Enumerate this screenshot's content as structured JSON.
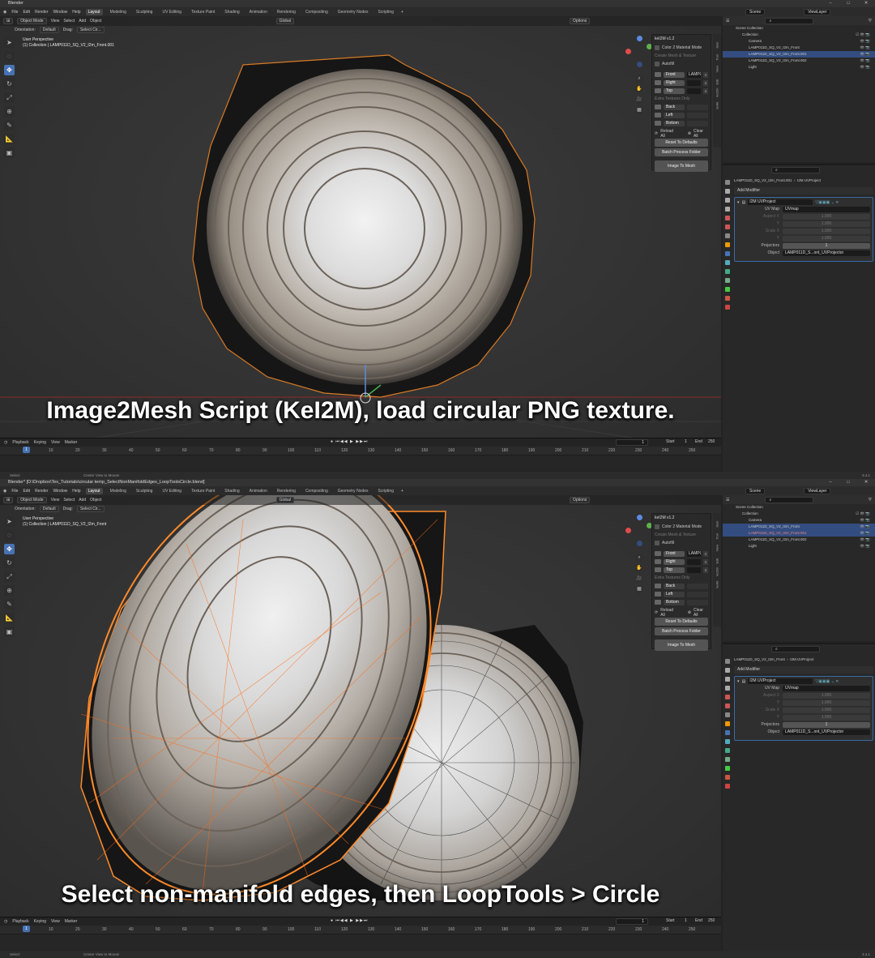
{
  "titlebar": {
    "top": "Blender",
    "bottom": "Blender* [D:\\Dropbox\\Tex_Tutorials\\circular temp_SelectNonManifoldEdges_LoopToolsCircle.blend]"
  },
  "menus": [
    "File",
    "Edit",
    "Render",
    "Window",
    "Help"
  ],
  "workspaces": [
    "Layout",
    "Modeling",
    "Sculpting",
    "UV Editing",
    "Texture Paint",
    "Shading",
    "Animation",
    "Rendering",
    "Compositing",
    "Geometry Nodes",
    "Scripting"
  ],
  "scene": "Scene",
  "view_layer": "ViewLayer",
  "header": {
    "mode": "Object Mode",
    "view": "View",
    "select": "Select",
    "add": "Add",
    "object": "Object",
    "transform": "Global",
    "options": "Options"
  },
  "header2": {
    "orientation": "Orientation:",
    "default": "Default",
    "drag": "Drag:",
    "select_mode": "Select Cir..."
  },
  "top": {
    "overlay_title": "User Perspective",
    "overlay_obj": "(1) Collection | LAMP011D_SQ_V2_I2m_Front.001",
    "caption": "Image2Mesh Script (KeI2M), load circular PNG texture."
  },
  "bottom": {
    "overlay_title": "User Perspective",
    "overlay_obj": "(1) Collection | LAMP011D_SQ_V2_I2m_Front",
    "caption": "Select non-manifold edges, then LoopTools > Circle"
  },
  "npanel": {
    "title": "keI2M v1.2",
    "color2": "Color 2 Material Mode",
    "create": "Create Mesh & Texture",
    "autofill": "Autofill",
    "front": "Front",
    "front_img": "LAMP011...",
    "right": "Right",
    "topl": "Top",
    "extra": "Extra Textures Only",
    "back": "Back",
    "left": "Left",
    "bottom": "Bottom",
    "reload": "Reload All",
    "clear": "Clear All",
    "reset": "Reset To Defaults",
    "batch": "Batch Process Folder",
    "img2mesh": "Image To Mesh",
    "tabs": [
      "Item",
      "Tool",
      "View",
      "Edit",
      "keI2m",
      "keKit"
    ]
  },
  "timeline": {
    "playback": "Playback",
    "keying": "Keying",
    "view": "View",
    "marker": "Marker",
    "frame": "1",
    "start_lbl": "Start",
    "start": "1",
    "end_lbl": "End",
    "end": "250",
    "ticks": [
      "1",
      "10",
      "20",
      "30",
      "40",
      "50",
      "60",
      "70",
      "80",
      "90",
      "100",
      "110",
      "120",
      "130",
      "140",
      "150",
      "160",
      "170",
      "180",
      "190",
      "200",
      "210",
      "220",
      "230",
      "240",
      "250"
    ]
  },
  "status": {
    "select": "Select",
    "center": "Center View to Mouse",
    "version": "3.4.1"
  },
  "outliner": {
    "root": "Scene Collection",
    "collection": "Collection",
    "camera": "Camera",
    "o1": "LAMP011D_SQ_V2_I2m_Front",
    "o2": "LAMP011D_SQ_V2_I2m_Front.001",
    "o3": "LAMP011D_SQ_V2_I2m_Front.002",
    "light": "Light"
  },
  "props": {
    "bc_top": "LAMP011D_SQ_V2_I2m_Front.001",
    "bc_bottom": "LAMP011D_SQ_V2_I2m_Front",
    "bc_mod": "I2M UVProject",
    "add_mod": "Add Modifier",
    "mod_name": "I2M UVProject",
    "uvmap_lbl": "UV Map",
    "uvmap": "UVmap",
    "aspx_lbl": "Aspect X",
    "y_lbl": "Y",
    "scalex_lbl": "Scale X",
    "val": "1.000",
    "proj_lbl": "Projectors",
    "proj": "1",
    "obj_lbl": "Object",
    "obj": "LAMP011D_S...ont_UVProjector"
  },
  "colors": {
    "accent": "#4772b3",
    "selection": "#ff8a2a",
    "wire": "#141414"
  }
}
